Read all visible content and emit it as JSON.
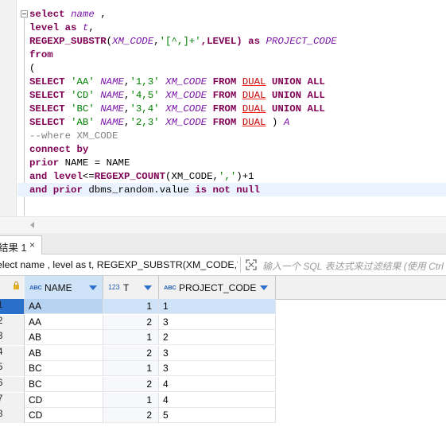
{
  "editor": {
    "lines": [
      [
        {
          "t": "select ",
          "c": "kw"
        },
        {
          "t": "name",
          "c": "id"
        },
        {
          "t": " ,",
          "c": ""
        }
      ],
      [
        {
          "t": "level as ",
          "c": "kw"
        },
        {
          "t": "t",
          "c": "id"
        },
        {
          "t": ",",
          "c": ""
        }
      ],
      [
        {
          "t": "REGEXP_SUBSTR",
          "c": "kw"
        },
        {
          "t": "(",
          "c": ""
        },
        {
          "t": "XM_CODE",
          "c": "id"
        },
        {
          "t": ",",
          "c": ""
        },
        {
          "t": "'[^,]+'",
          "c": "str"
        },
        {
          "t": ",LEVEL) ",
          "c": "kw"
        },
        {
          "t": "as ",
          "c": "kw"
        },
        {
          "t": "PROJECT_CODE",
          "c": "id"
        }
      ],
      [
        {
          "t": "from",
          "c": "kw"
        }
      ],
      [
        {
          "t": "(",
          "c": ""
        }
      ],
      [
        {
          "t": "SELECT ",
          "c": "kw"
        },
        {
          "t": "'AA' ",
          "c": "str"
        },
        {
          "t": "NAME",
          "c": "id"
        },
        {
          "t": ",",
          "c": ""
        },
        {
          "t": "'1,3' ",
          "c": "str"
        },
        {
          "t": "XM_CODE ",
          "c": "id"
        },
        {
          "t": "FROM ",
          "c": "kw"
        },
        {
          "t": "DUAL",
          "c": "dual"
        },
        {
          "t": " UNION ALL",
          "c": "kw"
        }
      ],
      [
        {
          "t": "SELECT ",
          "c": "kw"
        },
        {
          "t": "'CD' ",
          "c": "str"
        },
        {
          "t": "NAME",
          "c": "id"
        },
        {
          "t": ",",
          "c": ""
        },
        {
          "t": "'4,5' ",
          "c": "str"
        },
        {
          "t": "XM_CODE ",
          "c": "id"
        },
        {
          "t": "FROM ",
          "c": "kw"
        },
        {
          "t": "DUAL",
          "c": "dual"
        },
        {
          "t": " UNION ALL",
          "c": "kw"
        }
      ],
      [
        {
          "t": "SELECT ",
          "c": "kw"
        },
        {
          "t": "'BC' ",
          "c": "str"
        },
        {
          "t": "NAME",
          "c": "id"
        },
        {
          "t": ",",
          "c": ""
        },
        {
          "t": "'3,4' ",
          "c": "str"
        },
        {
          "t": "XM_CODE ",
          "c": "id"
        },
        {
          "t": "FROM ",
          "c": "kw"
        },
        {
          "t": "DUAL",
          "c": "dual"
        },
        {
          "t": " UNION ALL",
          "c": "kw"
        }
      ],
      [
        {
          "t": "SELECT ",
          "c": "kw"
        },
        {
          "t": "'AB' ",
          "c": "str"
        },
        {
          "t": "NAME",
          "c": "id"
        },
        {
          "t": ",",
          "c": ""
        },
        {
          "t": "'2,3' ",
          "c": "str"
        },
        {
          "t": "XM_CODE ",
          "c": "id"
        },
        {
          "t": "FROM ",
          "c": "kw"
        },
        {
          "t": "DUAL",
          "c": "dual"
        },
        {
          "t": " ) ",
          "c": ""
        },
        {
          "t": "A",
          "c": "id"
        }
      ],
      [
        {
          "t": "--where XM_CODE",
          "c": "cmt"
        }
      ],
      [
        {
          "t": "connect by",
          "c": "kw"
        }
      ],
      [
        {
          "t": "prior ",
          "c": "kw"
        },
        {
          "t": "NAME = NAME",
          "c": ""
        }
      ],
      [
        {
          "t": "and level",
          "c": "kw"
        },
        {
          "t": "<=",
          "c": ""
        },
        {
          "t": "REGEXP_COUNT",
          "c": "kw"
        },
        {
          "t": "(XM_CODE,",
          "c": ""
        },
        {
          "t": "','",
          "c": "str"
        },
        {
          "t": ")+1",
          "c": ""
        }
      ],
      [
        {
          "t": "and prior ",
          "c": "kw"
        },
        {
          "t": "dbms_random.value ",
          "c": ""
        },
        {
          "t": "is not null",
          "c": "kw"
        }
      ]
    ]
  },
  "results": {
    "tab_label": "结果 1",
    "tab_close": "×",
    "filter_sql": "elect name , level as t, REGEXP_SUBSTR(XM_CODE,'[",
    "filter_placeholder": "输入一个 SQL 表达式来过滤结果 (使用 Ctrl",
    "columns": [
      {
        "type": "ABC",
        "name": "NAME"
      },
      {
        "type": "123",
        "name": "T"
      },
      {
        "type": "ABC",
        "name": "PROJECT_CODE"
      }
    ],
    "rows": [
      {
        "num": "1",
        "name": "AA",
        "t": "1",
        "code": "1"
      },
      {
        "num": "2",
        "name": "AA",
        "t": "2",
        "code": "3"
      },
      {
        "num": "3",
        "name": "AB",
        "t": "1",
        "code": "2"
      },
      {
        "num": "4",
        "name": "AB",
        "t": "2",
        "code": "3"
      },
      {
        "num": "5",
        "name": "BC",
        "t": "1",
        "code": "3"
      },
      {
        "num": "6",
        "name": "BC",
        "t": "2",
        "code": "4"
      },
      {
        "num": "7",
        "name": "CD",
        "t": "1",
        "code": "4"
      },
      {
        "num": "8",
        "name": "CD",
        "t": "2",
        "code": "5"
      }
    ],
    "selected_row": 0
  }
}
